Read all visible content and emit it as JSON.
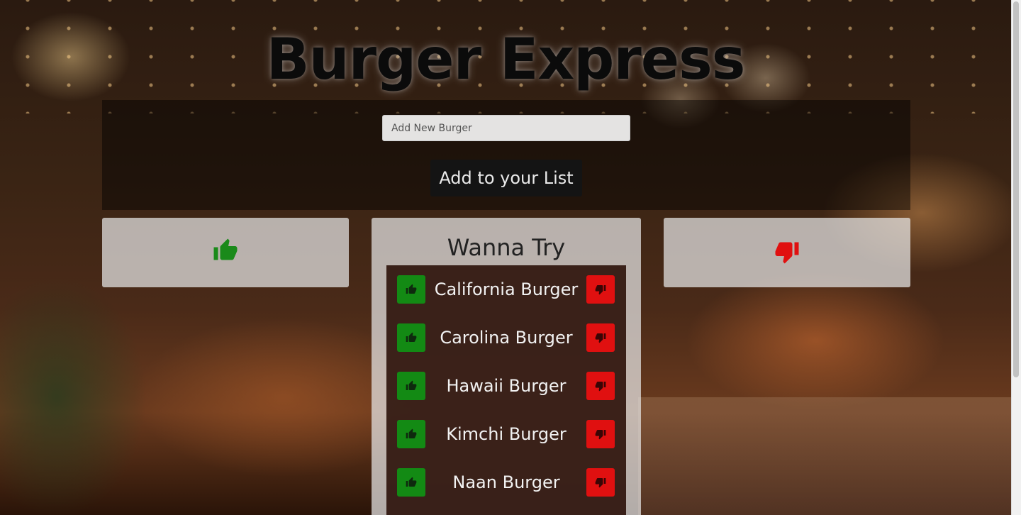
{
  "header": {
    "title": "Burger Express"
  },
  "form": {
    "input_placeholder": "Add New Burger",
    "submit_label": "Add to your List"
  },
  "devoured": {
    "icon": "thumbs-up-icon",
    "color": "#1a8a1a"
  },
  "rejected": {
    "icon": "thumbs-down-icon",
    "color": "#e01010"
  },
  "wanna_try": {
    "title": "Wanna Try",
    "items": [
      {
        "name": "California Burger"
      },
      {
        "name": "Carolina Burger"
      },
      {
        "name": "Hawaii Burger"
      },
      {
        "name": "Kimchi Burger"
      },
      {
        "name": "Naan Burger"
      }
    ]
  },
  "colors": {
    "upvote": "#138a14",
    "downvote": "#e01010"
  }
}
